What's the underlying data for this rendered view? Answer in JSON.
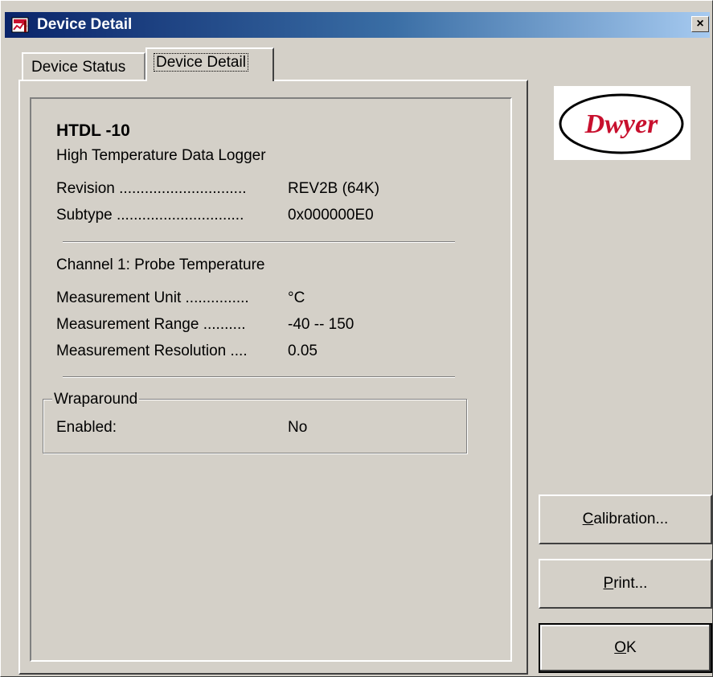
{
  "window": {
    "title": "Device Detail",
    "close_label": "×"
  },
  "tabs": [
    {
      "label": "Device Status",
      "selected": false
    },
    {
      "label": "Device Detail",
      "selected": true
    }
  ],
  "device": {
    "model": "HTDL -10",
    "description": "High Temperature Data Logger",
    "revision_label": "Revision ..............................",
    "revision_value": "REV2B (64K)",
    "subtype_label": "Subtype ..............................",
    "subtype_value": "0x000000E0"
  },
  "channel": {
    "title": "Channel 1: Probe Temperature",
    "unit_label": "Measurement Unit ...............",
    "unit_value": "°C",
    "range_label": "Measurement Range ..........",
    "range_value": "-40 -- 150",
    "resolution_label": "Measurement Resolution ....",
    "resolution_value": "0.05"
  },
  "wraparound": {
    "legend": "Wraparound",
    "enabled_label": "Enabled:",
    "enabled_value": "No"
  },
  "logo": {
    "text": "Dwyer",
    "color": "#c8102e"
  },
  "buttons": {
    "calibration": {
      "mnemonic": "C",
      "rest": "alibration..."
    },
    "print": {
      "mnemonic": "P",
      "rest": "rint..."
    },
    "ok": {
      "mnemonic": "O",
      "rest": "K"
    }
  },
  "colors": {
    "face": "#d4d0c8",
    "title_start": "#0a246a",
    "title_end": "#a6caf0"
  }
}
